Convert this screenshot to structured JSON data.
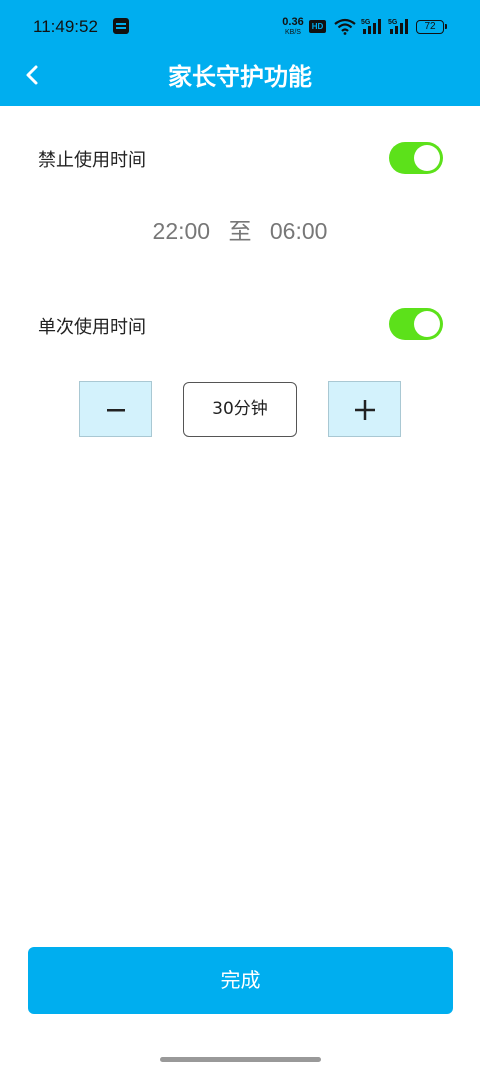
{
  "status_bar": {
    "time": "11:49:52",
    "net_speed_value": "0.36",
    "net_speed_unit": "KB/S",
    "hd_label": "HD",
    "signal_labels": [
      "5G",
      "5G"
    ],
    "battery": "72"
  },
  "header": {
    "title": "家长守护功能",
    "color": "#00AEEF"
  },
  "forbidden_time": {
    "label": "禁止使用时间",
    "enabled": true,
    "start": "22:00",
    "separator": "至",
    "end": "06:00"
  },
  "single_use": {
    "label": "单次使用时间",
    "enabled": true,
    "decrement_icon": "minus-icon",
    "increment_icon": "plus-icon",
    "value": "30分钟"
  },
  "footer": {
    "done_label": "完成"
  },
  "colors": {
    "accent": "#00AEEF",
    "toggle_on": "#5CE11A",
    "stepper_bg": "#D3F2FC"
  }
}
